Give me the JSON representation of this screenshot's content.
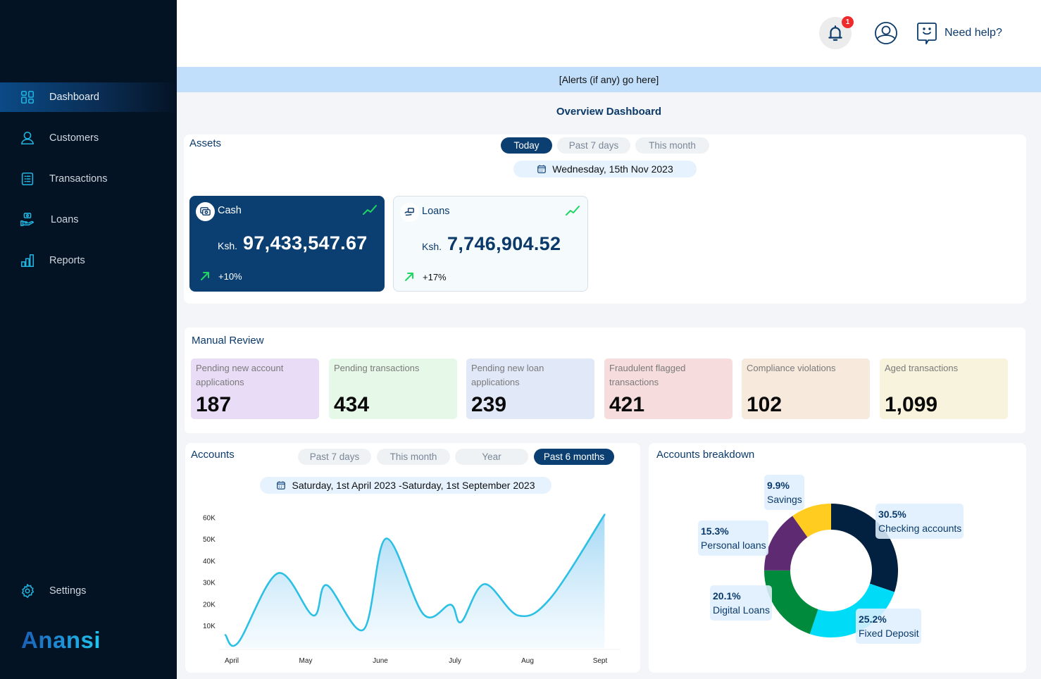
{
  "sidebar": {
    "items": [
      {
        "label": "Dashboard",
        "icon": "dashboard-grid-icon",
        "active": true
      },
      {
        "label": "Customers",
        "icon": "user-icon"
      },
      {
        "label": "Transactions",
        "icon": "receipt-list-icon"
      },
      {
        "label": "Loans",
        "icon": "hand-money-icon"
      },
      {
        "label": "Reports",
        "icon": "bar-chart-icon"
      }
    ],
    "settings": {
      "label": "Settings",
      "icon": "gear-icon"
    },
    "logo": "Anansi"
  },
  "header": {
    "notification_count": "1",
    "help_label": "Need help?"
  },
  "alert_bar": "[Alerts (if any) go here]",
  "page_title": "Overview Dashboard",
  "assets": {
    "title": "Assets",
    "filters": [
      "Today",
      "Past 7 days",
      "This month"
    ],
    "active_filter": "Today",
    "date": "Wednesday, 15th Nov 2023",
    "cards": [
      {
        "name": "Cash",
        "currency": "Ksh.",
        "value": "97,433,547.67",
        "delta": "+10%"
      },
      {
        "name": "Loans",
        "currency": "Ksh.",
        "value": "7,746,904.52",
        "delta": "+17%"
      }
    ]
  },
  "manual_review": {
    "title": "Manual Review",
    "cards": [
      {
        "label": "Pending new account applications",
        "value": "187",
        "color": "#e9dcf6"
      },
      {
        "label": "Pending transactions",
        "value": "434",
        "color": "#e6f9e8"
      },
      {
        "label": "Pending new loan applications",
        "value": "239",
        "color": "#e1e8f8"
      },
      {
        "label": "Fraudulent flagged transactions",
        "value": "421",
        "color": "#f7dcdd"
      },
      {
        "label": "Compliance violations",
        "value": "102",
        "color": "#f7e9dc"
      },
      {
        "label": "Aged transactions",
        "value": "1,099",
        "color": "#f8f3dd"
      }
    ]
  },
  "accounts": {
    "title": "Accounts",
    "filters": [
      "Past 7 days",
      "This month",
      "Year",
      "Past 6 months"
    ],
    "active_filter": "Past 6 months",
    "date_range": "Saturday, 1st April 2023  -Saturday, 1st September  2023"
  },
  "breakdown": {
    "title": "Accounts breakdown"
  },
  "chart_data": [
    {
      "type": "area",
      "title": "Accounts",
      "xlabel": "",
      "ylabel": "",
      "x_ticks": [
        "April",
        "May",
        "June",
        "July",
        "Aug",
        "Sept"
      ],
      "y_ticks": [
        "10K",
        "20K",
        "30K",
        "40K",
        "50K",
        "60K"
      ],
      "ylim": [
        0,
        65000
      ],
      "grid": false,
      "series": [
        {
          "name": "Accounts",
          "color": "#2cc0e4",
          "x": [
            0,
            0.17,
            0.7,
            1.17,
            1.35,
            1.84,
            2.14,
            2.64,
            3.0,
            3.14,
            3.45,
            3.9,
            4.33,
            5.05
          ],
          "y": [
            6000,
            2500,
            34500,
            15000,
            29000,
            8500,
            50500,
            15500,
            20000,
            12000,
            29500,
            15000,
            23000,
            61500
          ]
        }
      ]
    },
    {
      "type": "pie",
      "title": "Accounts breakdown",
      "donut": true,
      "slices": [
        {
          "label": "Checking accounts",
          "value": 30.5,
          "display": "30.5%",
          "color": "#02203f"
        },
        {
          "label": "Fixed Deposit",
          "value": 25.2,
          "display": "25.2%",
          "color": "#00dcf7"
        },
        {
          "label": "Digital Loans",
          "value": 20.1,
          "display": "20.1%",
          "color": "#008a3b"
        },
        {
          "label": "Personal loans",
          "value": 15.3,
          "display": "15.3%",
          "color": "#5e2a72"
        },
        {
          "label": "Savings",
          "value": 9.9,
          "display": "9.9%",
          "color": "#ffcc1f"
        }
      ]
    }
  ]
}
